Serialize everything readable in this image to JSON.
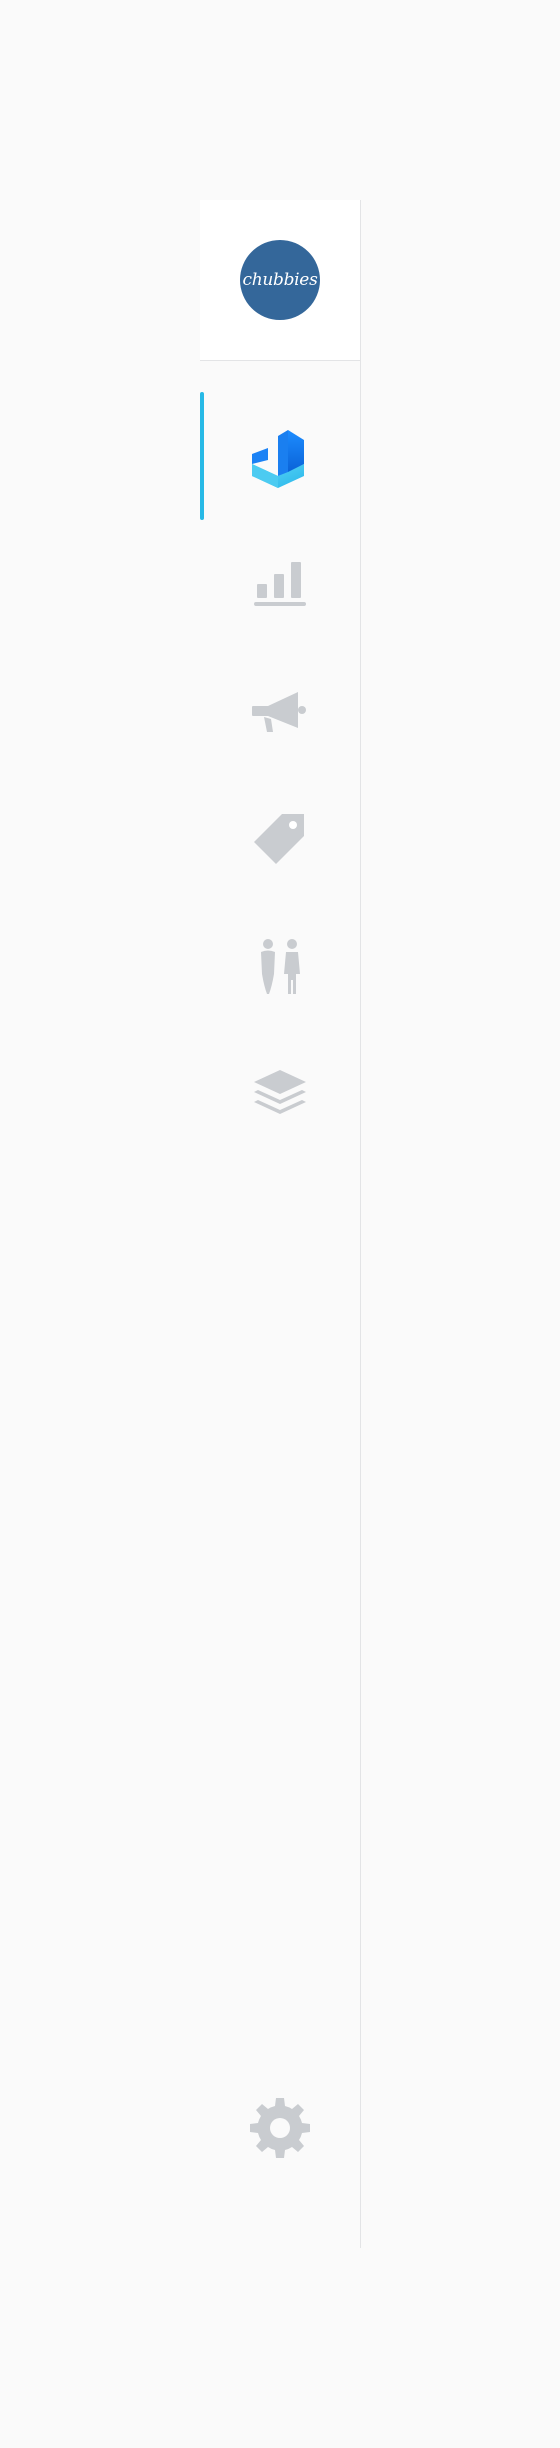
{
  "brand": {
    "logo_text": "chubbies",
    "logo_color": "#34679a"
  },
  "colors": {
    "active_indicator": "#27b9e6",
    "icon_inactive": "#c9ccd0",
    "border": "#e3e4e6"
  },
  "nav": {
    "items": [
      {
        "name": "home",
        "icon": "app-logo-icon",
        "active": true
      },
      {
        "name": "analytics",
        "icon": "bar-chart-icon",
        "active": false
      },
      {
        "name": "campaigns",
        "icon": "megaphone-icon",
        "active": false
      },
      {
        "name": "products",
        "icon": "tag-icon",
        "active": false
      },
      {
        "name": "audiences",
        "icon": "people-icon",
        "active": false
      },
      {
        "name": "integrations",
        "icon": "layers-icon",
        "active": false
      }
    ],
    "settings": {
      "icon": "gear-icon"
    }
  }
}
